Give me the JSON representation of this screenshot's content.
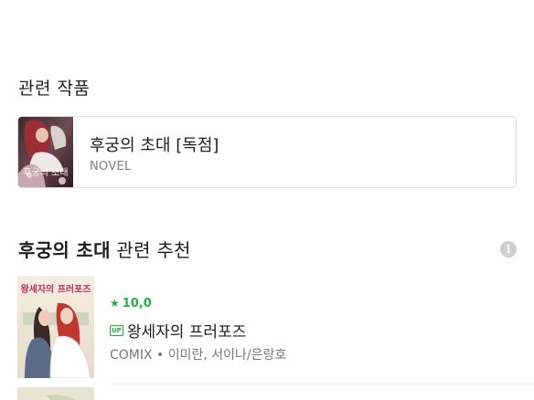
{
  "related_works": {
    "heading": "관련 작품",
    "item": {
      "title": "후궁의 초대 [독점]",
      "type": "NOVEL",
      "cover_text": "후궁의 초대"
    }
  },
  "recommendations": {
    "heading_bold": "후궁의 초대",
    "heading_rest": " 관련 추천",
    "info_icon": "info-icon",
    "items": [
      {
        "rating_icon": "★",
        "rating": "10,0",
        "badge": "UP",
        "title": "왕세자의 프러포즈",
        "meta": "COMIX • 이미란, 서이나/은랑호",
        "cover_text": "왕세자의 프러포즈"
      }
    ]
  },
  "colors": {
    "accent_green": "#1fb53a",
    "border": "#dcdcdc",
    "muted_text": "#808080"
  }
}
